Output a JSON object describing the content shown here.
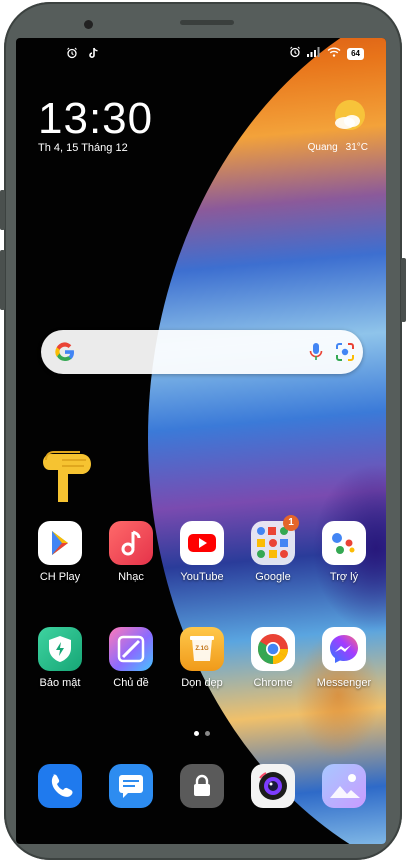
{
  "status_bar": {
    "left_icons": [
      "alarm-icon",
      "tiktok-icon"
    ],
    "right_icons": [
      "alarm-icon",
      "signal-icon",
      "wifi-icon"
    ],
    "battery": "64"
  },
  "lock_widget": {
    "time": "13:30",
    "date": "Th 4, 15 Tháng 12",
    "weather": {
      "location": "Quang",
      "temperature": "31°C",
      "icon": "partly-sunny-icon"
    }
  },
  "search_bar": {
    "icons": [
      "google-icon",
      "mic-icon",
      "lens-icon"
    ]
  },
  "pointer": {
    "icon": "pointing-hand-icon"
  },
  "apps_row1": [
    {
      "label": "CH Play",
      "icon": "play-store-icon"
    },
    {
      "label": "Nhạc",
      "icon": "music-icon"
    },
    {
      "label": "YouTube",
      "icon": "youtube-icon"
    },
    {
      "label": "Google",
      "icon": "google-folder-icon",
      "badge": "1"
    },
    {
      "label": "Trợ lý",
      "icon": "assistant-icon"
    }
  ],
  "apps_row2": [
    {
      "label": "Bảo mật",
      "icon": "security-icon"
    },
    {
      "label": "Chủ đề",
      "icon": "themes-icon"
    },
    {
      "label": "Dọn dẹp",
      "icon": "cleaner-icon",
      "sublabel": "Z.1G"
    },
    {
      "label": "Chrome",
      "icon": "chrome-icon"
    },
    {
      "label": "Messenger",
      "icon": "messenger-icon"
    }
  ],
  "page_indicator": {
    "pages": 2,
    "current": 1
  },
  "dock": [
    {
      "icon": "phone-icon"
    },
    {
      "icon": "messages-icon"
    },
    {
      "icon": "lock-icon"
    },
    {
      "icon": "camera-icon"
    },
    {
      "icon": "gallery-icon"
    }
  ],
  "colors": {
    "screen_bg": "#020202",
    "bezel": "#565d5b",
    "badge": "#e5652a",
    "weather_sun": "#f7c33a"
  }
}
